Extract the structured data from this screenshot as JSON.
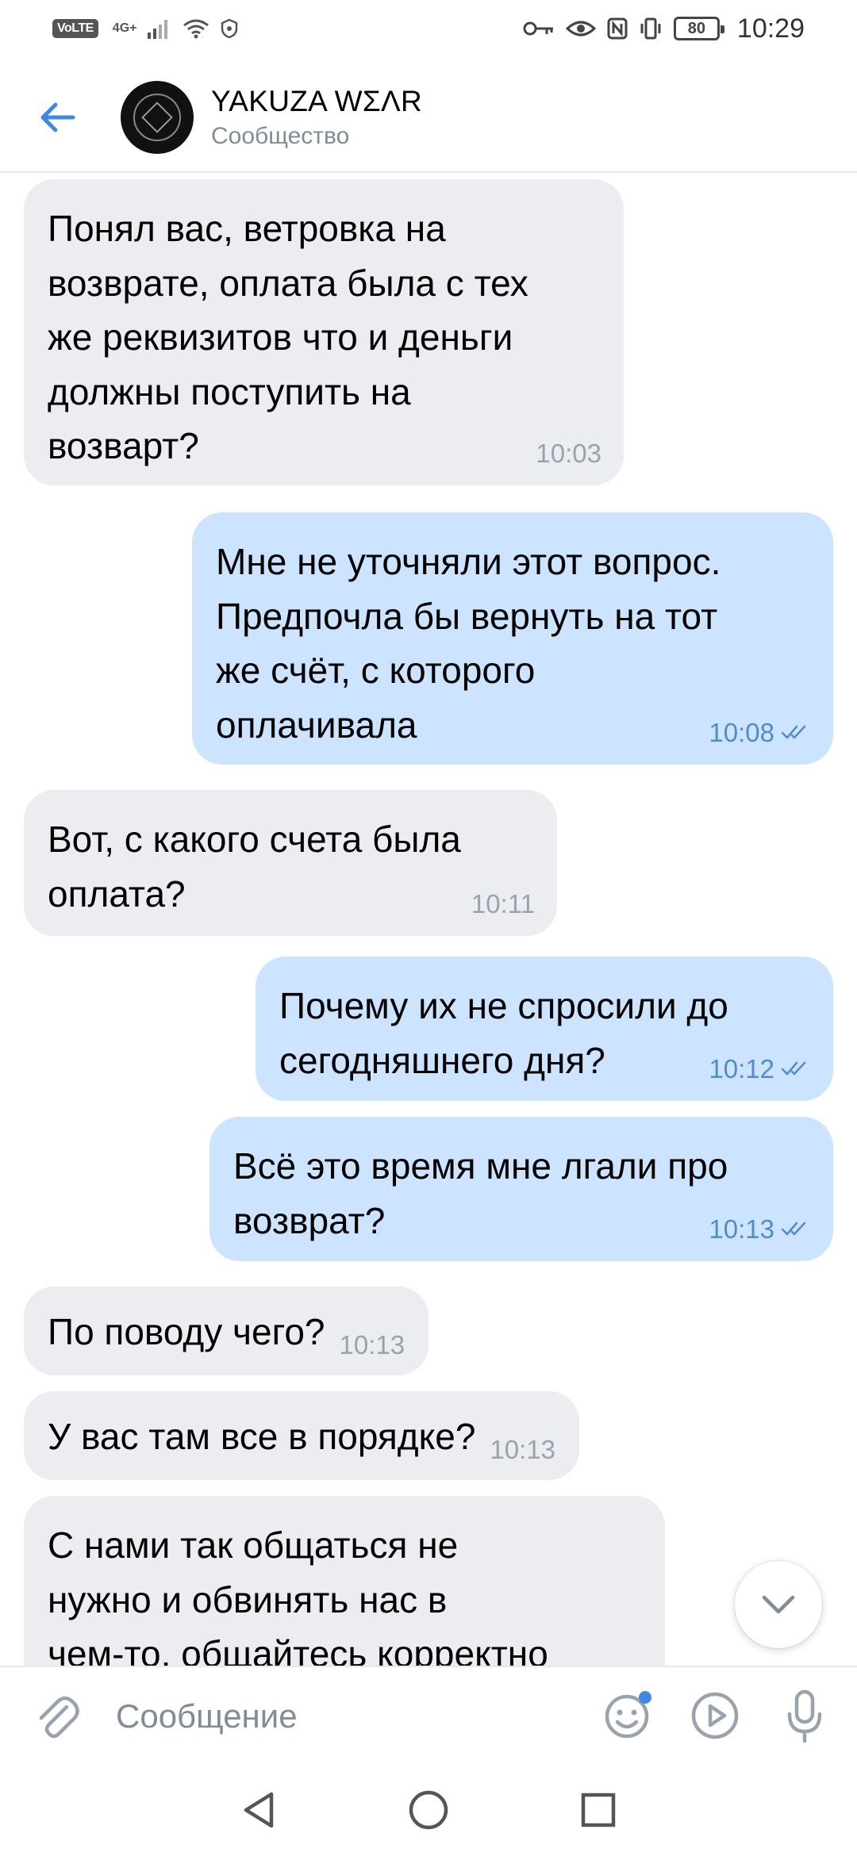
{
  "status_bar": {
    "volte": "VoLTE",
    "network": "4G+",
    "battery": "80",
    "time": "10:29"
  },
  "header": {
    "title": "YAKUZA WΣΛR",
    "subtitle": "Сообщество"
  },
  "messages": [
    {
      "direction": "in",
      "text": "Понял вас, ветровка на\nвозврате, оплата была с тех\nже реквизитов что и деньги\nдолжны поступить на\nвозварт?",
      "time": "10:03"
    },
    {
      "direction": "out",
      "text": "Мне не уточняли этот вопрос.\nПредпочла бы вернуть на тот\nже счёт, с которого\nоплачивала",
      "time": "10:08",
      "read": true
    },
    {
      "direction": "in",
      "text": "Вот, с какого счета была\nоплата?",
      "time": "10:11"
    },
    {
      "direction": "out",
      "text": "Почему их не спросили до\nсегодняшнего дня?",
      "time": "10:12",
      "read": true
    },
    {
      "direction": "out",
      "text": "Всё это время мне лгали про\nвозврат?",
      "time": "10:13",
      "read": true
    },
    {
      "direction": "in",
      "text": "По поводу чего?",
      "time": "10:13"
    },
    {
      "direction": "in",
      "text": "У вас там все в порядке?",
      "time": "10:13"
    },
    {
      "direction": "in",
      "text": "С нами так общаться не\nнужно и обвинять нас в\nчем-то, общайтесь корректно",
      "time": ""
    }
  ],
  "composer": {
    "placeholder": "Сообщение"
  },
  "icons": {
    "back": "arrow-left-icon",
    "attach": "paperclip-icon",
    "emoji": "smile-icon",
    "video_message": "play-circle-icon",
    "voice": "microphone-icon",
    "scroll_down": "chevron-down-icon"
  },
  "colors": {
    "accent": "#3f8ae0",
    "incoming_bubble": "#ebedf0",
    "outgoing_bubble": "#cce4ff",
    "secondary_text": "#818c99"
  }
}
